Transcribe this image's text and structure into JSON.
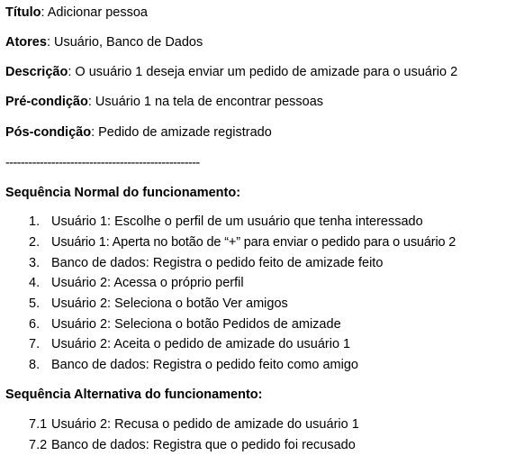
{
  "titulo": {
    "label": "Título",
    "sep": ": ",
    "value": "Adicionar pessoa"
  },
  "atores": {
    "label": "Atores",
    "sep": ": ",
    "value": "Usuário, Banco de Dados"
  },
  "descricao": {
    "label": "Descrição",
    "sep": ": ",
    "value": "O usuário 1 deseja enviar um pedido de amizade para o usuário 2"
  },
  "pre_condicao": {
    "label": "Pré-condição",
    "sep": ": ",
    "value": "Usuário 1 na tela de encontrar pessoas"
  },
  "pos_condicao": {
    "label": "Pós-condição",
    "sep": ": ",
    "value": "Pedido de amizade registrado"
  },
  "divider": "---------------------------------------------------",
  "normal": {
    "heading": "Sequência Normal do funcionamento:",
    "items": [
      {
        "num": "1.",
        "text": "Usuário 1: Escolhe o perfil de um usuário que tenha interessado"
      },
      {
        "num": "2.",
        "text": "Usuário 1: Aperta no botão de “+” para enviar o pedido para o usuário 2"
      },
      {
        "num": "3.",
        "text": "Banco de dados: Registra o pedido feito de amizade feito"
      },
      {
        "num": "4.",
        "text": "Usuário 2: Acessa o próprio perfil"
      },
      {
        "num": "5.",
        "text": "Usuário 2: Seleciona o botão Ver amigos"
      },
      {
        "num": "6.",
        "text": "Usuário 2: Seleciona o botão Pedidos de amizade"
      },
      {
        "num": "7.",
        "text": "Usuário 2: Aceita o pedido de amizade do usuário 1"
      },
      {
        "num": "8.",
        "text": "Banco de dados: Registra o pedido feito como amigo"
      }
    ]
  },
  "alternativa": {
    "heading": "Sequência Alternativa do funcionamento:",
    "items": [
      {
        "num": "7.1",
        "text": "Usuário 2: Recusa o pedido de amizade do usuário 1"
      },
      {
        "num": "7.2",
        "text": "Banco de dados: Registra que o pedido foi recusado"
      }
    ]
  }
}
